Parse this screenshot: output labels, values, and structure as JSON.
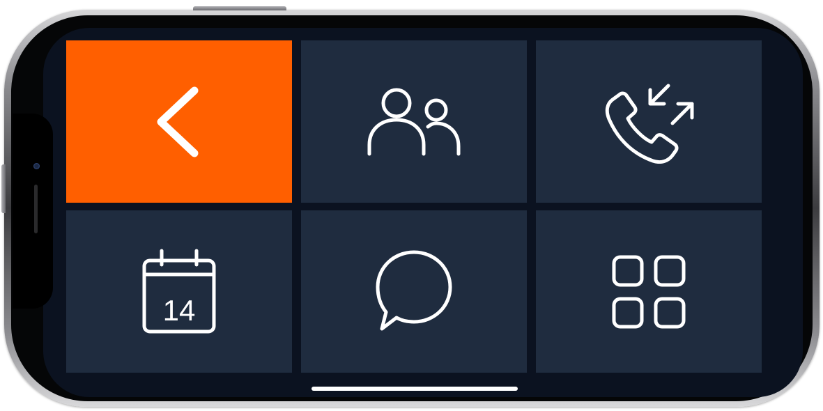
{
  "colors": {
    "accent": "#ff5f00",
    "tile": "#1f2c3f",
    "screen": "#0b1220",
    "icon": "#ffffff"
  },
  "tiles": [
    {
      "icon": "back-chevron-icon",
      "active": true
    },
    {
      "icon": "contacts-icon",
      "active": false
    },
    {
      "icon": "calls-icon",
      "active": false
    },
    {
      "icon": "calendar-icon",
      "active": false,
      "day": "14"
    },
    {
      "icon": "messages-icon",
      "active": false
    },
    {
      "icon": "apps-grid-icon",
      "active": false
    }
  ]
}
